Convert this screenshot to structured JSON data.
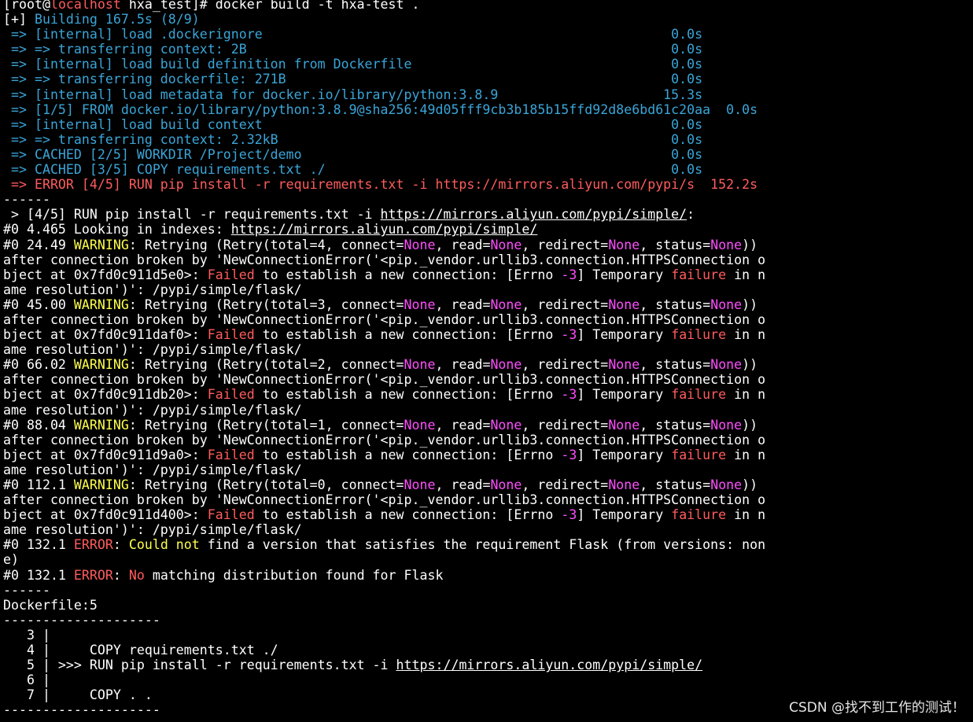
{
  "colors": {
    "background": "#000000",
    "text": "#ffffff",
    "info": "#3aa5d8",
    "error": "#ff5c5c",
    "warning": "#ffff4d",
    "keyword": "#ff4dff"
  },
  "watermark": "CSDN @找不到工作的测试！",
  "lines": [
    [
      {
        "t": "[root@",
        "c": "white"
      },
      {
        "t": "localhost",
        "c": "red"
      },
      {
        "t": " hxa_test]# docker build -t hxa-test .",
        "c": "white"
      }
    ],
    [
      {
        "t": "[+] ",
        "c": "white"
      },
      {
        "t": "Building 167.5s (8/9)",
        "c": "blue"
      }
    ],
    [
      {
        "t": " => [internal] load .dockerignore                                                    0.0s",
        "c": "blue"
      }
    ],
    [
      {
        "t": " => => transferring context: 2B                                                      0.0s",
        "c": "blue"
      }
    ],
    [
      {
        "t": " => [internal] load build definition from Dockerfile                                 0.0s",
        "c": "blue"
      }
    ],
    [
      {
        "t": " => => transferring dockerfile: 271B                                                 0.0s",
        "c": "blue"
      }
    ],
    [
      {
        "t": " => [internal] load metadata for docker.io/library/python:3.8.9                     15.3s",
        "c": "blue"
      }
    ],
    [
      {
        "t": " => [1/5] FROM docker.io/library/python:3.8.9@sha256:49d05fff9cb3b185b15ffd92d8e6bd61c20aa  0.0s",
        "c": "blue"
      }
    ],
    [
      {
        "t": " => [internal] load build context                                                    0.0s",
        "c": "blue"
      }
    ],
    [
      {
        "t": " => => transferring context: 2.32kB                                                  0.0s",
        "c": "blue"
      }
    ],
    [
      {
        "t": " => CACHED [2/5] WORKDIR /Project/demo                                               0.0s",
        "c": "blue"
      }
    ],
    [
      {
        "t": " => CACHED [3/5] COPY requirements.txt ./                                            0.0s",
        "c": "blue"
      }
    ],
    [
      {
        "t": " => ERROR [4/5] RUN pip install -r requirements.txt -i https://mirrors.aliyun.com/pypi/s  152.2s",
        "c": "err"
      }
    ],
    [
      {
        "t": "------",
        "c": "white"
      }
    ],
    [
      {
        "t": " > [4/5] RUN pip install -r requirements.txt -i ",
        "c": "white"
      },
      {
        "t": "https://mirrors.aliyun.com/pypi/simple/",
        "c": "link"
      },
      {
        "t": ":",
        "c": "white"
      }
    ],
    [
      {
        "t": "#0 4.465 Looking in indexes: ",
        "c": "white"
      },
      {
        "t": "https://mirrors.aliyun.com/pypi/simple/",
        "c": "link"
      }
    ],
    [
      {
        "t": "#0 24.49 ",
        "c": "white"
      },
      {
        "t": "WARNING",
        "c": "yellow"
      },
      {
        "t": ": Retrying (Retry(total=4, connect=",
        "c": "white"
      },
      {
        "t": "None",
        "c": "mag"
      },
      {
        "t": ", read=",
        "c": "white"
      },
      {
        "t": "None",
        "c": "mag"
      },
      {
        "t": ", redirect=",
        "c": "white"
      },
      {
        "t": "None",
        "c": "mag"
      },
      {
        "t": ", status=",
        "c": "white"
      },
      {
        "t": "None",
        "c": "mag"
      },
      {
        "t": "))",
        "c": "white"
      }
    ],
    [
      {
        "t": "after connection broken by 'NewConnectionError('<pip._vendor.urllib3.connection.HTTPSConnection o",
        "c": "white"
      }
    ],
    [
      {
        "t": "bject at 0x7fd0c911d5e0>: ",
        "c": "white"
      },
      {
        "t": "Failed",
        "c": "red"
      },
      {
        "t": " to establish a new connection: [Errno ",
        "c": "white"
      },
      {
        "t": "-3",
        "c": "mag"
      },
      {
        "t": "] Temporary ",
        "c": "white"
      },
      {
        "t": "failure",
        "c": "red"
      },
      {
        "t": " in n",
        "c": "white"
      }
    ],
    [
      {
        "t": "ame resolution')': /pypi/simple/flask/",
        "c": "white"
      }
    ],
    [
      {
        "t": "#0 45.00 ",
        "c": "white"
      },
      {
        "t": "WARNING",
        "c": "yellow"
      },
      {
        "t": ": Retrying (Retry(total=3, connect=",
        "c": "white"
      },
      {
        "t": "None",
        "c": "mag"
      },
      {
        "t": ", read=",
        "c": "white"
      },
      {
        "t": "None",
        "c": "mag"
      },
      {
        "t": ", redirect=",
        "c": "white"
      },
      {
        "t": "None",
        "c": "mag"
      },
      {
        "t": ", status=",
        "c": "white"
      },
      {
        "t": "None",
        "c": "mag"
      },
      {
        "t": "))",
        "c": "white"
      }
    ],
    [
      {
        "t": "after connection broken by 'NewConnectionError('<pip._vendor.urllib3.connection.HTTPSConnection o",
        "c": "white"
      }
    ],
    [
      {
        "t": "bject at 0x7fd0c911daf0>: ",
        "c": "white"
      },
      {
        "t": "Failed",
        "c": "red"
      },
      {
        "t": " to establish a new connection: [Errno ",
        "c": "white"
      },
      {
        "t": "-3",
        "c": "mag"
      },
      {
        "t": "] Temporary ",
        "c": "white"
      },
      {
        "t": "failure",
        "c": "red"
      },
      {
        "t": " in n",
        "c": "white"
      }
    ],
    [
      {
        "t": "ame resolution')': /pypi/simple/flask/",
        "c": "white"
      }
    ],
    [
      {
        "t": "#0 66.02 ",
        "c": "white"
      },
      {
        "t": "WARNING",
        "c": "yellow"
      },
      {
        "t": ": Retrying (Retry(total=2, connect=",
        "c": "white"
      },
      {
        "t": "None",
        "c": "mag"
      },
      {
        "t": ", read=",
        "c": "white"
      },
      {
        "t": "None",
        "c": "mag"
      },
      {
        "t": ", redirect=",
        "c": "white"
      },
      {
        "t": "None",
        "c": "mag"
      },
      {
        "t": ", status=",
        "c": "white"
      },
      {
        "t": "None",
        "c": "mag"
      },
      {
        "t": "))",
        "c": "white"
      }
    ],
    [
      {
        "t": "after connection broken by 'NewConnectionError('<pip._vendor.urllib3.connection.HTTPSConnection o",
        "c": "white"
      }
    ],
    [
      {
        "t": "bject at 0x7fd0c911db20>: ",
        "c": "white"
      },
      {
        "t": "Failed",
        "c": "red"
      },
      {
        "t": " to establish a new connection: [Errno ",
        "c": "white"
      },
      {
        "t": "-3",
        "c": "mag"
      },
      {
        "t": "] Temporary ",
        "c": "white"
      },
      {
        "t": "failure",
        "c": "red"
      },
      {
        "t": " in n",
        "c": "white"
      }
    ],
    [
      {
        "t": "ame resolution')': /pypi/simple/flask/",
        "c": "white"
      }
    ],
    [
      {
        "t": "#0 88.04 ",
        "c": "white"
      },
      {
        "t": "WARNING",
        "c": "yellow"
      },
      {
        "t": ": Retrying (Retry(total=1, connect=",
        "c": "white"
      },
      {
        "t": "None",
        "c": "mag"
      },
      {
        "t": ", read=",
        "c": "white"
      },
      {
        "t": "None",
        "c": "mag"
      },
      {
        "t": ", redirect=",
        "c": "white"
      },
      {
        "t": "None",
        "c": "mag"
      },
      {
        "t": ", status=",
        "c": "white"
      },
      {
        "t": "None",
        "c": "mag"
      },
      {
        "t": "))",
        "c": "white"
      }
    ],
    [
      {
        "t": "after connection broken by 'NewConnectionError('<pip._vendor.urllib3.connection.HTTPSConnection o",
        "c": "white"
      }
    ],
    [
      {
        "t": "bject at 0x7fd0c911d9a0>: ",
        "c": "white"
      },
      {
        "t": "Failed",
        "c": "red"
      },
      {
        "t": " to establish a new connection: [Errno ",
        "c": "white"
      },
      {
        "t": "-3",
        "c": "mag"
      },
      {
        "t": "] Temporary ",
        "c": "white"
      },
      {
        "t": "failure",
        "c": "red"
      },
      {
        "t": " in n",
        "c": "white"
      }
    ],
    [
      {
        "t": "ame resolution')': /pypi/simple/flask/",
        "c": "white"
      }
    ],
    [
      {
        "t": "#0 112.1 ",
        "c": "white"
      },
      {
        "t": "WARNING",
        "c": "yellow"
      },
      {
        "t": ": Retrying (Retry(total=0, connect=",
        "c": "white"
      },
      {
        "t": "None",
        "c": "mag"
      },
      {
        "t": ", read=",
        "c": "white"
      },
      {
        "t": "None",
        "c": "mag"
      },
      {
        "t": ", redirect=",
        "c": "white"
      },
      {
        "t": "None",
        "c": "mag"
      },
      {
        "t": ", status=",
        "c": "white"
      },
      {
        "t": "None",
        "c": "mag"
      },
      {
        "t": "))",
        "c": "white"
      }
    ],
    [
      {
        "t": "after connection broken by 'NewConnectionError('<pip._vendor.urllib3.connection.HTTPSConnection o",
        "c": "white"
      }
    ],
    [
      {
        "t": "bject at 0x7fd0c911d400>: ",
        "c": "white"
      },
      {
        "t": "Failed",
        "c": "red"
      },
      {
        "t": " to establish a new connection: [Errno ",
        "c": "white"
      },
      {
        "t": "-3",
        "c": "mag"
      },
      {
        "t": "] Temporary ",
        "c": "white"
      },
      {
        "t": "failure",
        "c": "red"
      },
      {
        "t": " in n",
        "c": "white"
      }
    ],
    [
      {
        "t": "ame resolution')': /pypi/simple/flask/",
        "c": "white"
      }
    ],
    [
      {
        "t": "#0 132.1 ",
        "c": "white"
      },
      {
        "t": "ERROR",
        "c": "red"
      },
      {
        "t": ": ",
        "c": "white"
      },
      {
        "t": "Could not",
        "c": "yellow"
      },
      {
        "t": " find a version that satisfies the requirement Flask (from versions: non",
        "c": "white"
      }
    ],
    [
      {
        "t": "e)",
        "c": "white"
      }
    ],
    [
      {
        "t": "#0 132.1 ",
        "c": "white"
      },
      {
        "t": "ERROR",
        "c": "red"
      },
      {
        "t": ": ",
        "c": "white"
      },
      {
        "t": "No",
        "c": "red"
      },
      {
        "t": " matching distribution found for Flask",
        "c": "white"
      }
    ],
    [
      {
        "t": "------",
        "c": "white"
      }
    ],
    [
      {
        "t": "Dockerfile:5",
        "c": "white"
      }
    ],
    [
      {
        "t": "--------------------",
        "c": "white"
      }
    ],
    [
      {
        "t": "   3 |",
        "c": "white"
      }
    ],
    [
      {
        "t": "   4 |     COPY requirements.txt ./",
        "c": "white"
      }
    ],
    [
      {
        "t": "   5 | >>> RUN pip install -r requirements.txt -i ",
        "c": "white"
      },
      {
        "t": "https://mirrors.aliyun.com/pypi/simple/",
        "c": "link"
      }
    ],
    [
      {
        "t": "   6 |",
        "c": "white"
      }
    ],
    [
      {
        "t": "   7 |     COPY . .",
        "c": "white"
      }
    ],
    [
      {
        "t": "--------------------",
        "c": "white"
      }
    ]
  ]
}
